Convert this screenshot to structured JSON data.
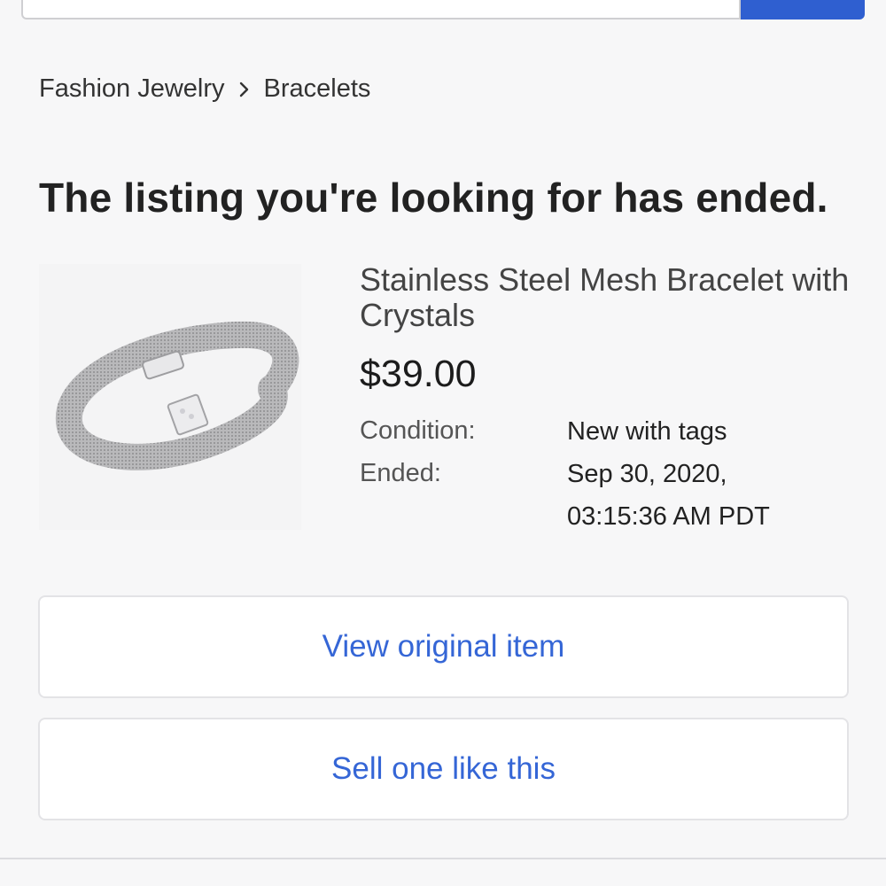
{
  "breadcrumb": {
    "items": [
      "Fashion Jewelry",
      "Bracelets"
    ]
  },
  "notice": {
    "title": "The listing you're looking for has ended."
  },
  "item": {
    "title": "Stainless Steel Mesh Bracelet with Crystals",
    "price": "$39.00",
    "condition_label": "Condition:",
    "condition_value": "New with tags",
    "ended_label": "Ended:",
    "ended_value_line1": "Sep 30, 2020,",
    "ended_value_line2": "03:15:36 AM PDT",
    "image_icon": "bracelet-image"
  },
  "actions": {
    "view_original_label": "View original item",
    "sell_one_label": "Sell one like this"
  },
  "colors": {
    "accent": "#2f5fd0",
    "link": "#3566d6",
    "background": "#f7f7f8"
  }
}
